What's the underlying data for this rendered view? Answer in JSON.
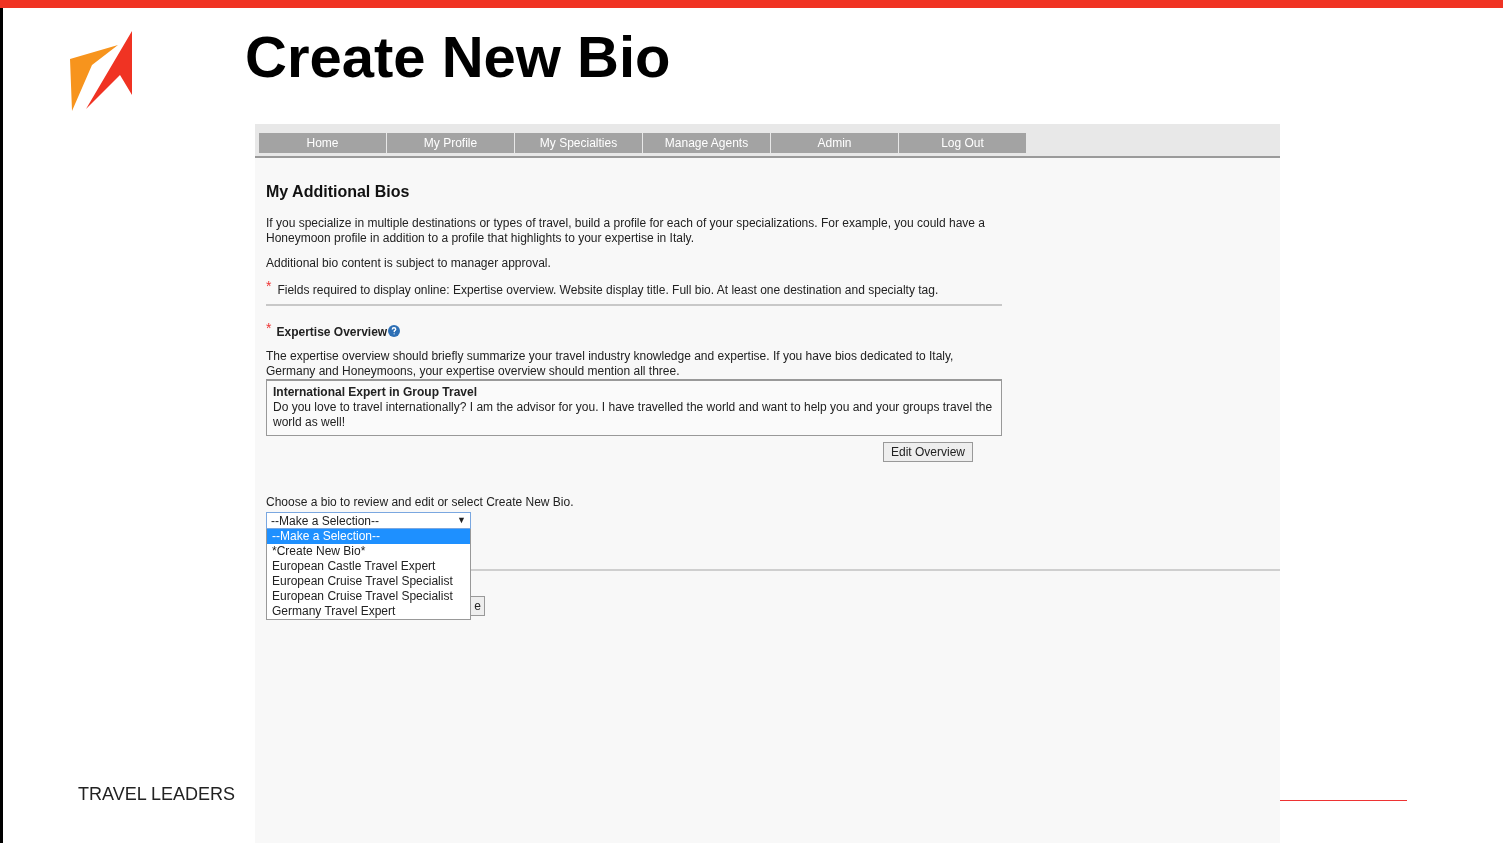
{
  "slide": {
    "title": "Create New Bio",
    "footer": "TRAVEL LEADERS"
  },
  "nav": [
    {
      "label": "Home"
    },
    {
      "label": "My Profile"
    },
    {
      "label": "My Specialties"
    },
    {
      "label": "Manage Agents"
    },
    {
      "label": "Admin"
    },
    {
      "label": "Log Out"
    }
  ],
  "page": {
    "heading": "My Additional Bios",
    "intro": "If you specialize in multiple destinations or types of travel, build a profile for each of your specializations. For example, you could have a Honeymoon profile in addition to a profile that highlights to your expertise in Italy.",
    "approval_note": "Additional bio content is subject to manager approval.",
    "required_note": {
      "marker": "*",
      "text": "Fields required to display online: Expertise overview. Website display title. Full bio. At least one destination and specialty tag."
    },
    "expertise": {
      "marker": "*",
      "label": "Expertise Overview",
      "description": "The expertise overview should briefly summarize your travel industry knowledge and expertise. If you have bios dedicated to Italy, Germany and Honeymoons, your expertise overview should mention all three.",
      "box_title": "International Expert in Group Travel",
      "box_text": "Do you love to travel internationally? I am the advisor for you. I have travelled the world and want to help you and your groups travel the world as well!",
      "edit_button": "Edit Overview"
    },
    "bio_chooser": {
      "prompt": "Choose a bio to review and edit or select Create New Bio.",
      "select_value": "--Make a Selection--",
      "arrow": "▼",
      "open": true,
      "options": [
        {
          "label": "--Make a Selection--",
          "selected": true
        },
        {
          "label": "*Create New Bio*",
          "selected": false
        },
        {
          "label": "European Castle Travel Expert",
          "selected": false
        },
        {
          "label": "European Cruise Travel Specialist",
          "selected": false
        },
        {
          "label": "European Cruise Travel Specialist",
          "selected": false
        },
        {
          "label": "Germany Travel Expert",
          "selected": false
        }
      ]
    },
    "partial_button": "e"
  }
}
